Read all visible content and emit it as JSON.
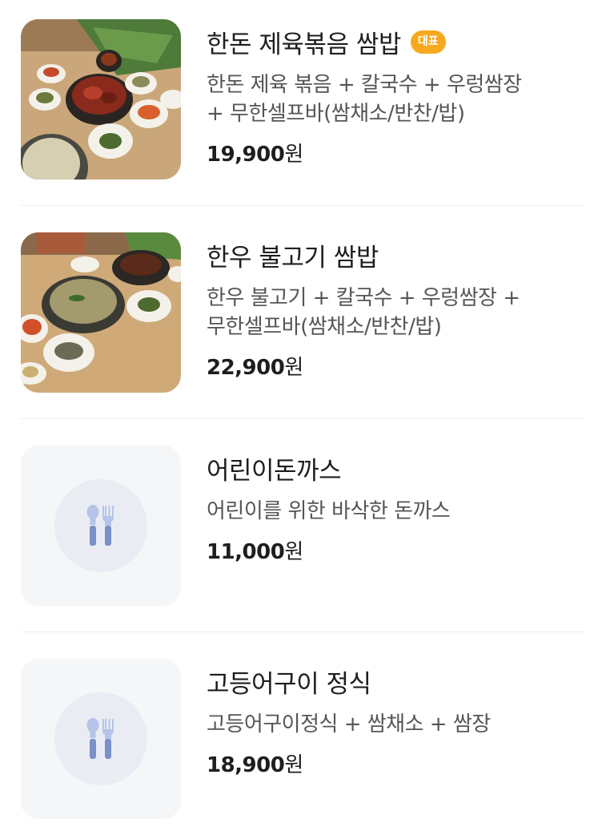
{
  "menu": {
    "items": [
      {
        "name": "한돈 제육볶음 쌈밥",
        "badge": "대표",
        "desc_lines": [
          "한돈 제육 볶음 + 칼국수 + 우렁쌈장",
          "+ 무한셀프바(쌈채소/반찬/밥)"
        ],
        "price": "19,900",
        "currency": "원",
        "image": "food-photo"
      },
      {
        "name": "한우 불고기 쌈밥",
        "desc_lines": [
          "한우 불고기 + 칼국수 + 우렁쌈장 +",
          "무한셀프바(쌈채소/반찬/밥)"
        ],
        "price": "22,900",
        "currency": "원",
        "image": "food-photo"
      },
      {
        "name": "어린이돈까스",
        "desc_lines": [
          "어린이를 위한 바삭한 돈까스"
        ],
        "price": "11,000",
        "currency": "원",
        "image": "spoon-fork-icon"
      },
      {
        "name": "고등어구이 정식",
        "desc_lines": [
          "고등어구이정식 + 쌈채소 + 쌈장"
        ],
        "price": "18,900",
        "currency": "원",
        "image": "spoon-fork-icon"
      }
    ]
  },
  "colors": {
    "badge": "#f6a91f",
    "placeholder_bg": "#f5f6f8",
    "icon": "#8fa3d4"
  }
}
